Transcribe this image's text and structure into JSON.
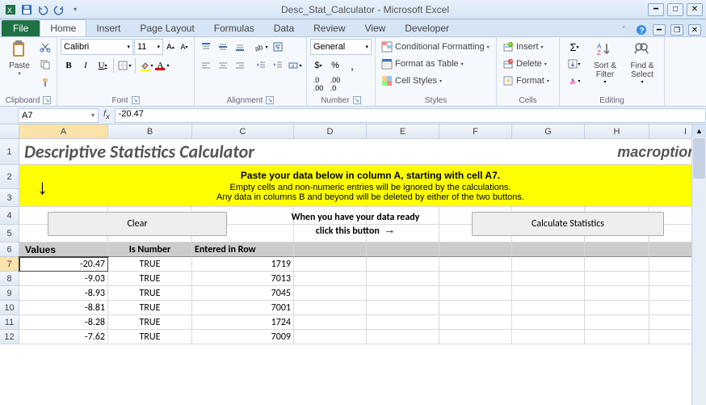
{
  "titlebar": {
    "title": "Desc_Stat_Calculator - Microsoft Excel"
  },
  "tabs": {
    "file": "File",
    "items": [
      "Home",
      "Insert",
      "Page Layout",
      "Formulas",
      "Data",
      "Review",
      "View",
      "Developer"
    ],
    "active": "Home"
  },
  "ribbon": {
    "clipboard": {
      "label": "Clipboard",
      "paste": "Paste"
    },
    "font": {
      "label": "Font",
      "name": "Calibri",
      "size": "11"
    },
    "alignment": {
      "label": "Alignment"
    },
    "number": {
      "label": "Number",
      "format": "General"
    },
    "styles": {
      "label": "Styles",
      "conditional": "Conditional Formatting",
      "table": "Format as Table",
      "cellstyles": "Cell Styles"
    },
    "cells": {
      "label": "Cells",
      "insert": "Insert",
      "delete": "Delete",
      "format": "Format"
    },
    "editing": {
      "label": "Editing",
      "sort": "Sort & Filter",
      "find": "Find & Select"
    }
  },
  "namebox": "A7",
  "formula": "-20.47",
  "columns": [
    "A",
    "B",
    "C",
    "D",
    "E",
    "F",
    "G",
    "H",
    "I"
  ],
  "sheet": {
    "title": "Descriptive Statistics Calculator",
    "brand": "macroption",
    "yellow": {
      "bold": "Paste your data below in column A, starting with cell A7.",
      "line1": "Empty cells and non-numeric entries will be ignored by the calculations.",
      "line2": "Any data in columns B and beyond will be deleted by either of the two buttons."
    },
    "clear_btn": "Clear",
    "mid1": "When you have your data ready",
    "mid2": "click this button",
    "calc_btn": "Calculate Statistics",
    "headers": [
      "Values",
      "Is Number",
      "Entered in Row"
    ],
    "data": [
      {
        "row": 7,
        "value": "-20.47",
        "isnum": "TRUE",
        "entered": "1719"
      },
      {
        "row": 8,
        "value": "-9.03",
        "isnum": "TRUE",
        "entered": "7013"
      },
      {
        "row": 9,
        "value": "-8.93",
        "isnum": "TRUE",
        "entered": "7045"
      },
      {
        "row": 10,
        "value": "-8.81",
        "isnum": "TRUE",
        "entered": "7001"
      },
      {
        "row": 11,
        "value": "-8.28",
        "isnum": "TRUE",
        "entered": "1724"
      },
      {
        "row": 12,
        "value": "-7.62",
        "isnum": "TRUE",
        "entered": "7009"
      }
    ]
  }
}
